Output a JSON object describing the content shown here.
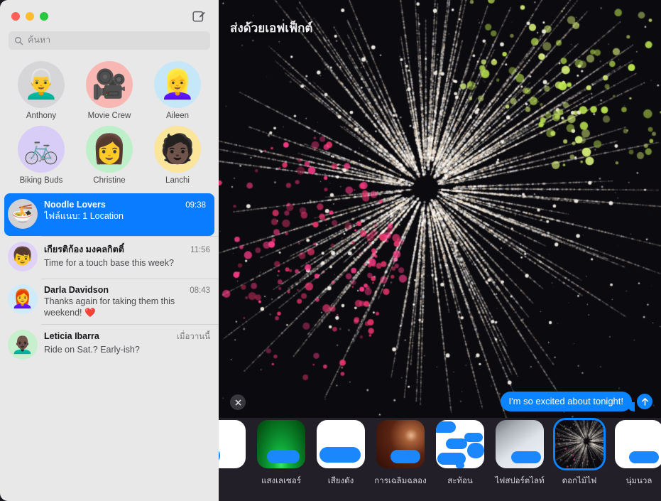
{
  "window": {
    "traffic_lights": [
      "close",
      "minimize",
      "zoom"
    ],
    "compose_icon": "compose-icon"
  },
  "search": {
    "placeholder": "ค้นหา",
    "icon": "search-icon",
    "value": ""
  },
  "pinned": {
    "items": [
      {
        "label": "Anthony",
        "glyph": "👨‍🦳",
        "bg": "#d6d6d8",
        "icon_name": "avatar-anthony"
      },
      {
        "label": "Movie Crew",
        "glyph": "🎥",
        "bg": "#f9b7b3",
        "icon_name": "avatar-movie-crew"
      },
      {
        "label": "Aileen",
        "glyph": "👱‍♀️",
        "bg": "#c6e7f8",
        "icon_name": "avatar-aileen"
      },
      {
        "label": "Biking Buds",
        "glyph": "🚲",
        "bg": "#d8cdf6",
        "icon_name": "avatar-biking-buds"
      },
      {
        "label": "Christine",
        "glyph": "👩",
        "bg": "#bdf0c8",
        "icon_name": "avatar-christine"
      },
      {
        "label": "Lanchi",
        "glyph": "🧑🏿",
        "bg": "#fbe59b",
        "icon_name": "avatar-lanchi"
      }
    ]
  },
  "conversations": {
    "items": [
      {
        "name": "Noodle Lovers",
        "time": "09:38",
        "preview": "ไฟล์แนบ:  1 Location",
        "glyph": "🍜",
        "bg": "#d2d2d4",
        "selected": true
      },
      {
        "name": "เกียรติก้อง มงคลกิตติ์",
        "time": "11:56",
        "preview": "Time for a touch base this week?",
        "glyph": "👦",
        "bg": "#e0d2f7",
        "selected": false
      },
      {
        "name": "Darla Davidson",
        "time": "08:43",
        "preview": "Thanks again for taking them this weekend! ❤️",
        "glyph": "👩‍🦰",
        "bg": "#cfeaf8",
        "selected": false
      },
      {
        "name": "Leticia Ibarra",
        "time": "เมื่อวานนี้",
        "preview": "Ride on Sat.? Early-ish?",
        "glyph": "👨🏿‍🦲",
        "bg": "#c7eecd",
        "selected": false
      }
    ]
  },
  "effect_screen": {
    "title": "ส่งด้วยเอฟเฟ็กต์",
    "close_icon": "close-icon",
    "message_text": "I'm so excited about tonight!",
    "send_icon": "send-arrow-icon",
    "bubble_color": "#0b84ff",
    "background_color": "#0b0a0e",
    "accent_color": "#0b84ff"
  },
  "effects": {
    "items": [
      {
        "label": "",
        "style": "partial",
        "selected": false,
        "name": "effect-partial-left"
      },
      {
        "label": "แสงเลเซอร์",
        "style": "laser",
        "selected": false,
        "name": "effect-lasers"
      },
      {
        "label": "เสียงดัง",
        "style": "loud",
        "selected": false,
        "name": "effect-loud"
      },
      {
        "label": "การเฉลิมฉลอง",
        "style": "celebrate",
        "selected": false,
        "name": "effect-celebration"
      },
      {
        "label": "สะท้อน",
        "style": "echo",
        "selected": false,
        "name": "effect-echo"
      },
      {
        "label": "ไฟสปอร์ตไลท์",
        "style": "spotlight",
        "selected": false,
        "name": "effect-spotlight"
      },
      {
        "label": "ดอกไม้ไฟ",
        "style": "fireworks",
        "selected": true,
        "name": "effect-fireworks"
      },
      {
        "label": "นุ่มนวล",
        "style": "gentle",
        "selected": false,
        "name": "effect-gentle"
      }
    ]
  }
}
